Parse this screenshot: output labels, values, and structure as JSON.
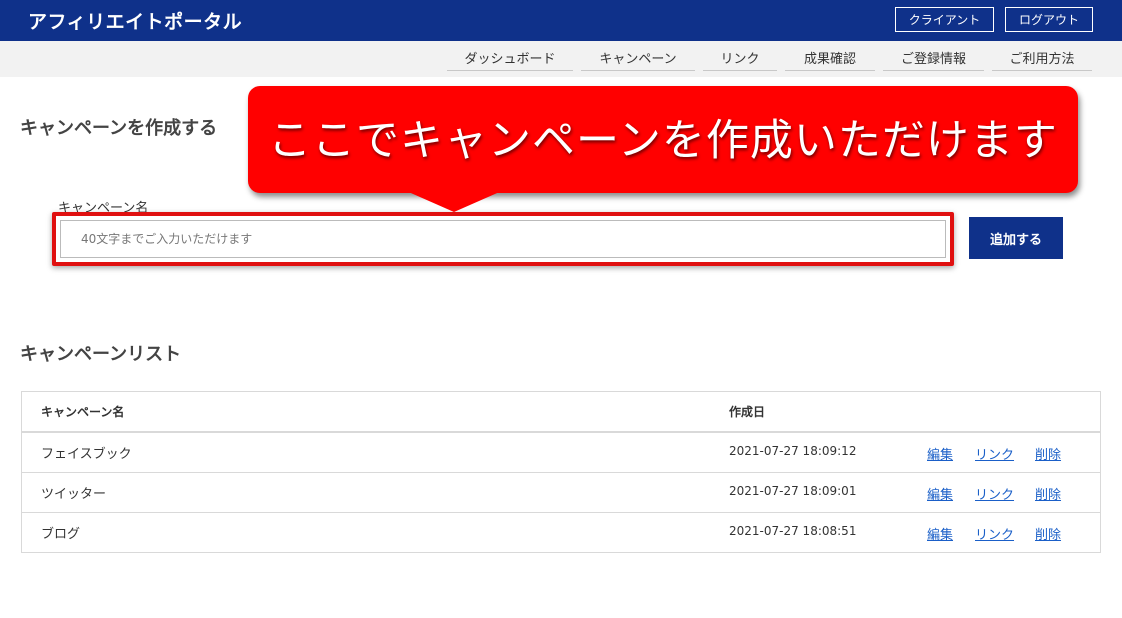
{
  "header": {
    "brand": "アフィリエイトポータル",
    "client_label": "クライアント",
    "logout_label": "ログアウト"
  },
  "nav": {
    "items": [
      {
        "label": "ダッシュボード"
      },
      {
        "label": "キャンペーン"
      },
      {
        "label": "リンク"
      },
      {
        "label": "成果確認"
      },
      {
        "label": "ご登録情報"
      },
      {
        "label": "ご利用方法"
      }
    ]
  },
  "create": {
    "title": "キャンペーンを作成する",
    "field_label": "キャンペーン名",
    "placeholder": "40文字までご入力いただけます",
    "value": "",
    "add_label": "追加する"
  },
  "callout": {
    "text": "ここでキャンペーンを作成いただけます"
  },
  "list": {
    "title": "キャンペーンリスト",
    "columns": [
      "キャンペーン名",
      "作成日"
    ],
    "rows": [
      {
        "name": "フェイスブック",
        "date": "2021-07-27 18:09:12",
        "edit": "編集",
        "link": "リンク",
        "delete": "削除"
      },
      {
        "name": "ツイッター",
        "date": "2021-07-27 18:09:01",
        "edit": "編集",
        "link": "リンク",
        "delete": "削除"
      },
      {
        "name": "ブログ",
        "date": "2021-07-27 18:08:51",
        "edit": "編集",
        "link": "リンク",
        "delete": "削除"
      }
    ]
  },
  "colors": {
    "brand": "#0f318a",
    "callout": "#ff0000",
    "link": "#1a5fc8"
  }
}
